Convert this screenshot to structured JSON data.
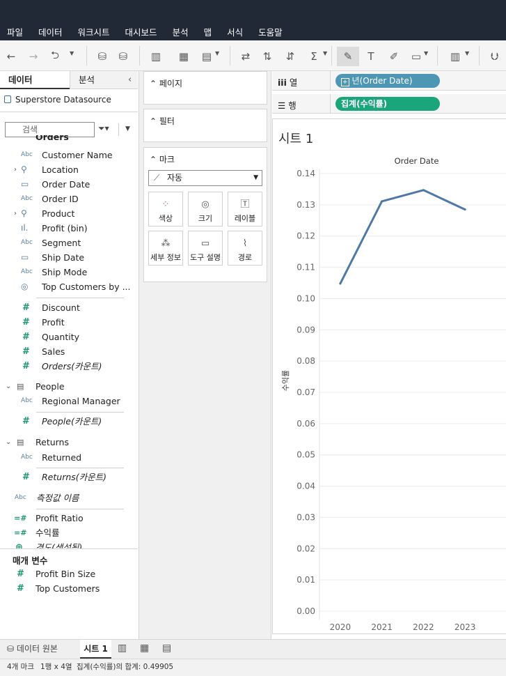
{
  "menu": [
    "파일",
    "데이터",
    "워크시트",
    "대시보드",
    "분석",
    "맵",
    "서식",
    "도움말"
  ],
  "left_pane": {
    "tab_data": "데이터",
    "tab_analysis": "분석",
    "datasource": "Superstore Datasource",
    "search_placeholder": "검색",
    "orders_group": "Orders",
    "orders_fields": [
      {
        "icon": "Abc",
        "label": "Customer Name"
      },
      {
        "icon": "hierarchy",
        "label": "Location"
      },
      {
        "icon": "calendar",
        "label": "Order Date"
      },
      {
        "icon": "Abc",
        "label": "Order ID"
      },
      {
        "icon": "hierarchy",
        "label": "Product"
      },
      {
        "icon": "bin",
        "label": "Profit (bin)"
      },
      {
        "icon": "Abc",
        "label": "Segment"
      },
      {
        "icon": "calendar",
        "label": "Ship Date"
      },
      {
        "icon": "Abc",
        "label": "Ship Mode"
      },
      {
        "icon": "set",
        "label": "Top Customers by ..."
      }
    ],
    "orders_measures": [
      "Discount",
      "Profit",
      "Quantity",
      "Sales",
      "Orders(카운트)"
    ],
    "people_group": "People",
    "people_fields": [
      "Regional Manager"
    ],
    "people_measure": "People(카운트)",
    "returns_group": "Returns",
    "returns_fields": [
      "Returned"
    ],
    "returns_measure": "Returns(카운트)",
    "measure_names": "측정값 이름",
    "calc_fields": [
      "Profit Ratio",
      "수익률",
      "경도(생성됨)"
    ],
    "params_title": "매개 변수",
    "params": [
      "Profit Bin Size",
      "Top Customers"
    ]
  },
  "middle_pane": {
    "pages": "페이지",
    "filters": "필터",
    "marks": "마크",
    "mark_type": "자동",
    "mark_buttons": [
      "색상",
      "크기",
      "레이블",
      "세부 정보",
      "도구 설명",
      "경로"
    ]
  },
  "shelves": {
    "columns_label": "열",
    "columns_pill": "년(Order Date)",
    "rows_label": "행",
    "rows_pill": "집계(수익률)",
    "columns_color": "#4e97b4",
    "rows_color": "#1aa57a"
  },
  "sheet": {
    "title": "시트 1"
  },
  "chart_data": {
    "type": "line",
    "title": "Order Date",
    "ylabel": "수익률",
    "x": [
      "2020",
      "2021",
      "2022",
      "2023"
    ],
    "y": [
      0.1048,
      0.1311,
      0.1347,
      0.1285
    ],
    "ylim": [
      0,
      0.14
    ],
    "yticks": [
      "0.00",
      "0.01",
      "0.02",
      "0.03",
      "0.04",
      "0.05",
      "0.06",
      "0.07",
      "0.08",
      "0.09",
      "0.10",
      "0.11",
      "0.12",
      "0.13",
      "0.14"
    ],
    "line_color": "#4e79a7",
    "grid": "horizontal"
  },
  "bottom_tabs": {
    "datasource": "데이터 원본",
    "sheet": "시트 1"
  },
  "status": {
    "marks": "4개 마크",
    "dims": "1행 x 4열",
    "sum": "집계(수익률)의 합계: 0.49905"
  }
}
